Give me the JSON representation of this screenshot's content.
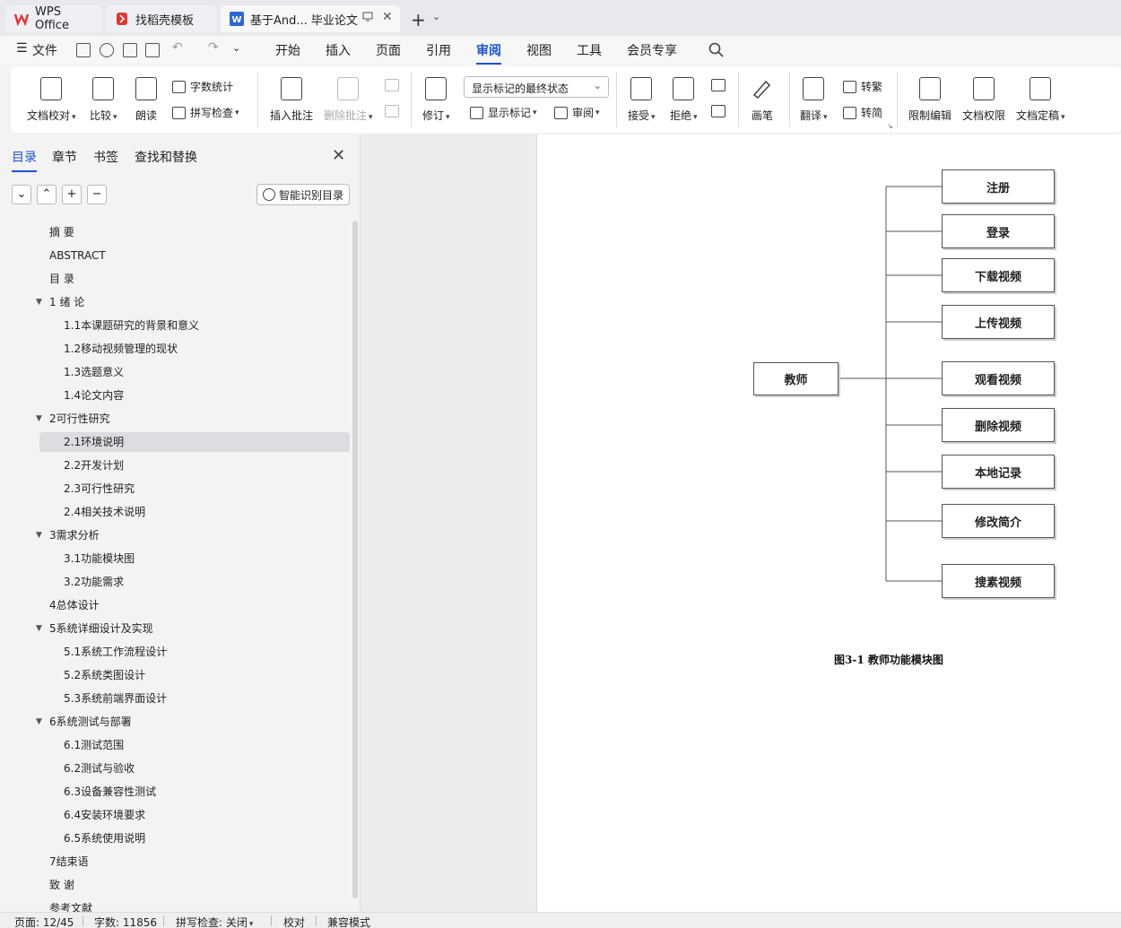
{
  "tabs": [
    {
      "label": "WPS Office",
      "color": "#e8332f"
    },
    {
      "label": "找稻壳模板",
      "color": "#e8332f"
    },
    {
      "label": "基于And... 毕业论文",
      "color": "#2b66d9"
    }
  ],
  "menu": {
    "file": "文件",
    "items": [
      "开始",
      "插入",
      "页面",
      "引用",
      "审阅",
      "视图",
      "工具",
      "会员专享"
    ],
    "active": "审阅"
  },
  "ribbon": {
    "doc_check": "文档校对",
    "compare": "比较",
    "read_aloud": "朗读",
    "word_count": "字数统计",
    "spell_check": "拼写检查",
    "insert_comment": "插入批注",
    "delete_comment": "删除批注",
    "track_changes": "修订",
    "display_state": "显示标记的最终状态",
    "show_markup": "显示标记",
    "review": "审阅",
    "accept": "接受",
    "reject": "拒绝",
    "pen": "画笔",
    "translate": "翻译",
    "to_traditional": "转繁",
    "to_simplified": "转简",
    "restrict_edit": "限制编辑",
    "doc_permission": "文档权限",
    "doc_finalize": "文档定稿"
  },
  "sidebar": {
    "tabs": [
      "目录",
      "章节",
      "书签",
      "查找和替换"
    ],
    "active_tab": "目录",
    "smart_toc": "智能识别目录",
    "toc": [
      {
        "label": "摘 要",
        "level": 0,
        "expand": false
      },
      {
        "label": "ABSTRACT",
        "level": 0,
        "expand": false
      },
      {
        "label": "目 录",
        "level": 0,
        "expand": false
      },
      {
        "label": "1 绪 论",
        "level": 0,
        "expand": true
      },
      {
        "label": "1.1本课题研究的背景和意义",
        "level": 1,
        "expand": false
      },
      {
        "label": "1.2移动视频管理的现状",
        "level": 1,
        "expand": false
      },
      {
        "label": "1.3选题意义",
        "level": 1,
        "expand": false
      },
      {
        "label": "1.4论文内容",
        "level": 1,
        "expand": false
      },
      {
        "label": "2可行性研究",
        "level": 0,
        "expand": true
      },
      {
        "label": "2.1环境说明",
        "level": 1,
        "expand": false,
        "selected": true
      },
      {
        "label": "2.2开发计划",
        "level": 1,
        "expand": false
      },
      {
        "label": "2.3可行性研究",
        "level": 1,
        "expand": false
      },
      {
        "label": "2.4相关技术说明",
        "level": 1,
        "expand": false
      },
      {
        "label": "3需求分析",
        "level": 0,
        "expand": true
      },
      {
        "label": "3.1功能模块图",
        "level": 1,
        "expand": false
      },
      {
        "label": "3.2功能需求",
        "level": 1,
        "expand": false
      },
      {
        "label": "4总体设计",
        "level": 0,
        "expand": false
      },
      {
        "label": "5系统详细设计及实现",
        "level": 0,
        "expand": true
      },
      {
        "label": "5.1系统工作流程设计",
        "level": 1,
        "expand": false
      },
      {
        "label": "5.2系统类图设计",
        "level": 1,
        "expand": false
      },
      {
        "label": "5.3系统前端界面设计",
        "level": 1,
        "expand": false
      },
      {
        "label": "6系统测试与部署",
        "level": 0,
        "expand": true
      },
      {
        "label": "6.1测试范围",
        "level": 1,
        "expand": false
      },
      {
        "label": "6.2测试与验收",
        "level": 1,
        "expand": false
      },
      {
        "label": "6.3设备兼容性测试",
        "level": 1,
        "expand": false
      },
      {
        "label": "6.4安装环境要求",
        "level": 1,
        "expand": false
      },
      {
        "label": "6.5系统使用说明",
        "level": 1,
        "expand": false
      },
      {
        "label": "7结束语",
        "level": 0,
        "expand": false
      },
      {
        "label": "致 谢",
        "level": 0,
        "expand": false
      },
      {
        "label": "参考文献",
        "level": 0,
        "expand": false
      }
    ]
  },
  "diagram": {
    "root": "教师",
    "modules": [
      "注册",
      "登录",
      "下载视频",
      "上传视频",
      "观看视频",
      "删除视频",
      "本地记录",
      "修改简介",
      "搜素视频"
    ],
    "caption": "图3-1  教师功能模块图"
  },
  "status": {
    "page": "页面: 12/45",
    "words": "字数: 11856",
    "spell": "拼写检查: 关闭",
    "proof": "校对",
    "compat": "兼容模式"
  },
  "colors": {
    "accent": "#1a55d6"
  }
}
